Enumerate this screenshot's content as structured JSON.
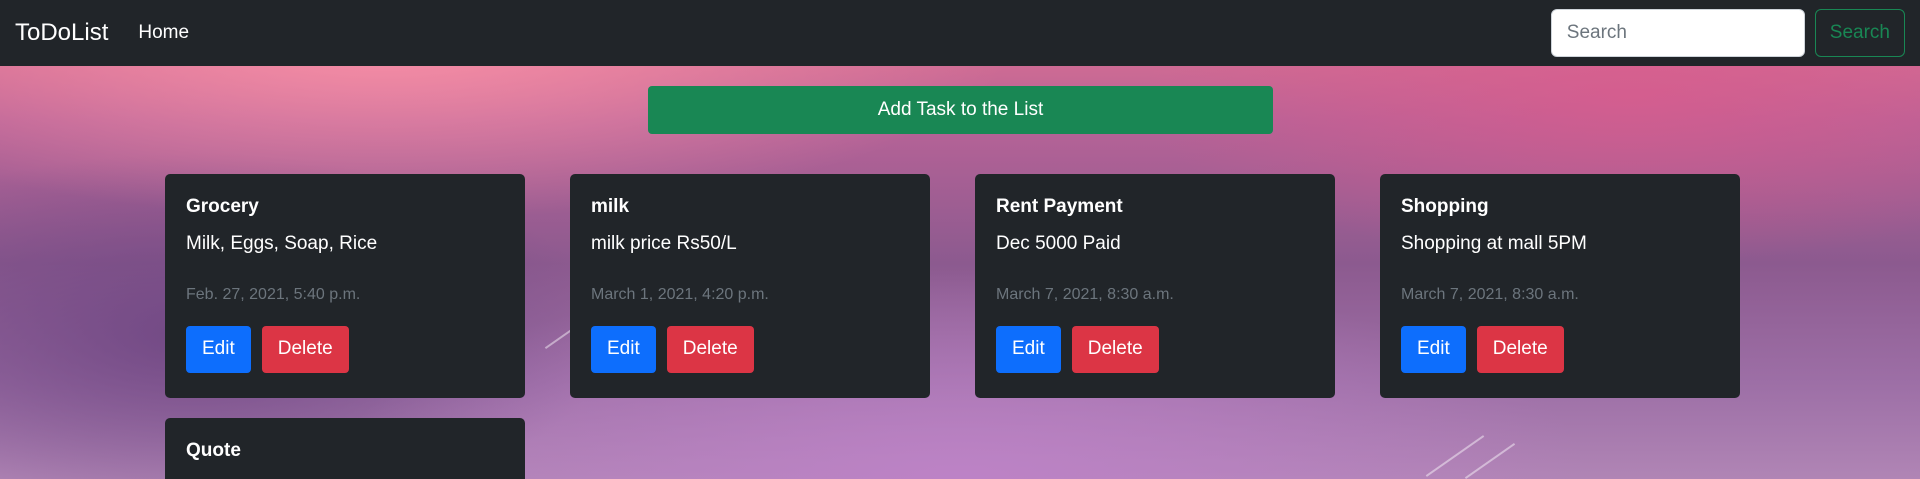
{
  "navbar": {
    "brand": "ToDoList",
    "home_label": "Home",
    "search_placeholder": "Search",
    "search_button": "Search"
  },
  "add_task_label": "Add Task to the List",
  "tasks": [
    {
      "title": "Grocery",
      "description": "Milk, Eggs, Soap, Rice",
      "date": "Feb. 27, 2021, 5:40 p.m.",
      "edit": "Edit",
      "delete": "Delete"
    },
    {
      "title": "milk",
      "description": "milk price Rs50/L",
      "date": "March 1, 2021, 4:20 p.m.",
      "edit": "Edit",
      "delete": "Delete"
    },
    {
      "title": "Rent Payment",
      "description": "Dec 5000 Paid",
      "date": "March 7, 2021, 8:30 a.m.",
      "edit": "Edit",
      "delete": "Delete"
    },
    {
      "title": "Shopping",
      "description": "Shopping at mall 5PM",
      "date": "March 7, 2021, 8:30 a.m.",
      "edit": "Edit",
      "delete": "Delete"
    },
    {
      "title": "Quote"
    }
  ],
  "colors": {
    "navbar": "#212529",
    "success": "#198754",
    "primary": "#0d6efd",
    "danger": "#dc3545",
    "muted": "#6c757d"
  }
}
